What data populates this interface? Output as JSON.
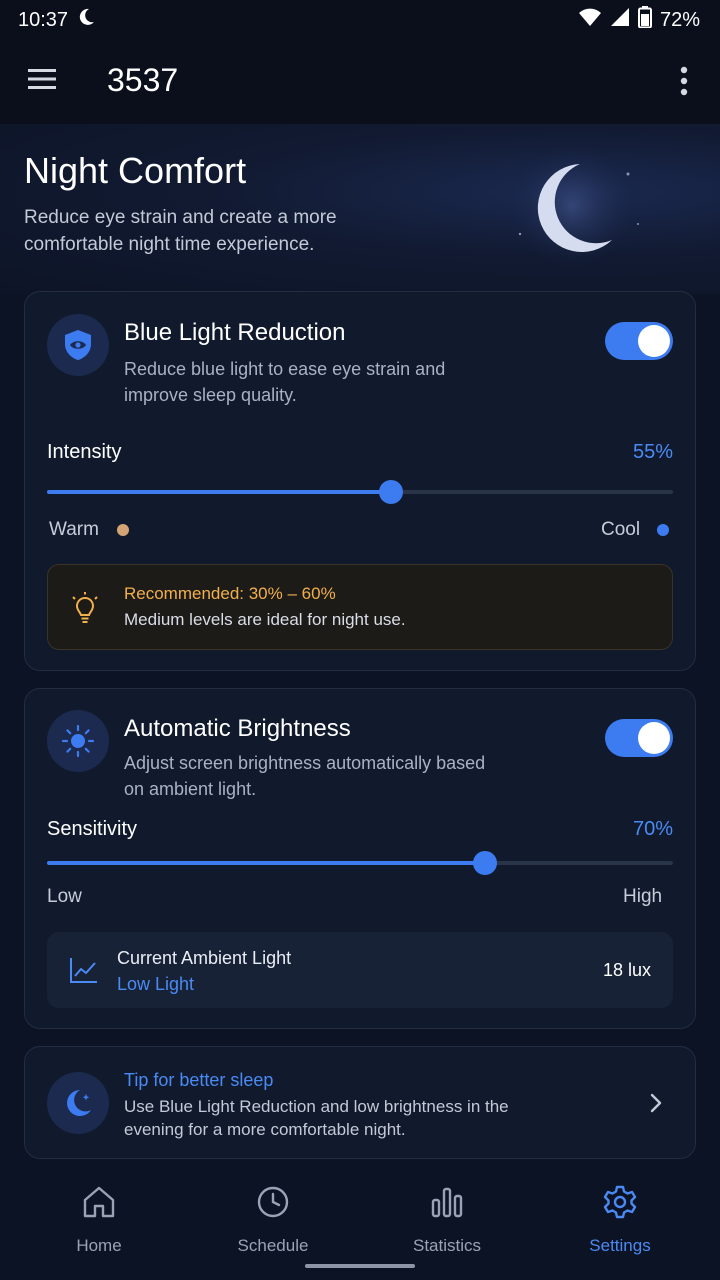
{
  "status_bar": {
    "time": "10:37",
    "battery": "72%"
  },
  "app_bar": {
    "title": "3537"
  },
  "hero": {
    "title": "Night Comfort",
    "subtitle": "Reduce eye strain and create a more comfortable night time experience."
  },
  "blue_light": {
    "title": "Blue Light Reduction",
    "description": "Reduce blue light to ease eye strain and improve sleep quality.",
    "enabled": true,
    "intensity_label": "Intensity",
    "intensity_value": 55,
    "intensity_text": "55%",
    "warm_label": "Warm",
    "cool_label": "Cool",
    "recommendation_title": "Recommended: 30% – 60%",
    "recommendation_text": "Medium levels are ideal for night use."
  },
  "auto_brightness": {
    "title": "Automatic Brightness",
    "description": "Adjust screen brightness automatically based on ambient light.",
    "enabled": true,
    "sensitivity_label": "Sensitivity",
    "sensitivity_value": 70,
    "sensitivity_text": "70%",
    "low_label": "Low",
    "high_label": "High",
    "ambient_title": "Current Ambient Light",
    "ambient_level": "Low Light",
    "ambient_value": "18 lux"
  },
  "tip": {
    "title": "Tip for better sleep",
    "text": "Use Blue Light Reduction and low brightness in the evening for a more comfortable night."
  },
  "bottom_nav": {
    "items": [
      {
        "label": "Home",
        "icon": "home-icon"
      },
      {
        "label": "Schedule",
        "icon": "clock-icon"
      },
      {
        "label": "Statistics",
        "icon": "bar-chart-icon"
      },
      {
        "label": "Settings",
        "icon": "gear-icon",
        "active": true
      }
    ]
  },
  "colors": {
    "accent": "#3d7bf0",
    "accent_text": "#4a8af4",
    "warm_dot": "#d4a574",
    "warning": "#f2b04c",
    "background": "#0c1324",
    "card": "#111a2c"
  }
}
